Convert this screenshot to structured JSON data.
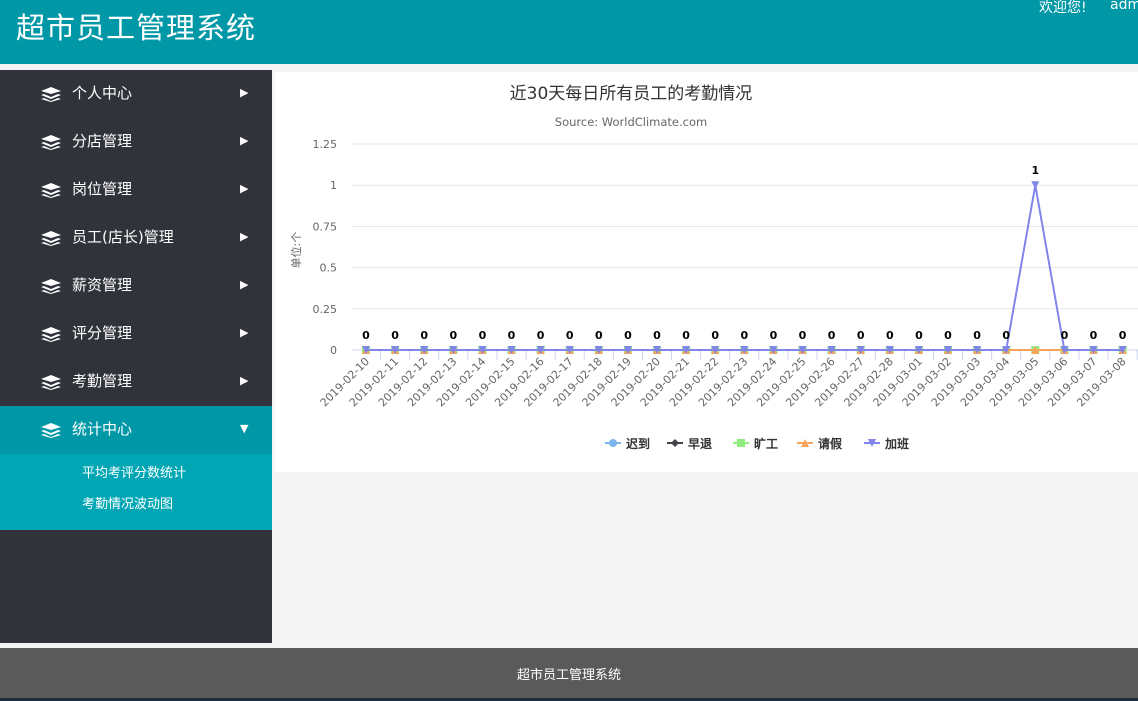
{
  "header": {
    "title": "超市员工管理系统",
    "welcome": "欢迎您!",
    "user": "adm"
  },
  "sidebar": {
    "items": [
      {
        "label": "个人中心",
        "name": "personal-center"
      },
      {
        "label": "分店管理",
        "name": "branch-management"
      },
      {
        "label": "岗位管理",
        "name": "position-management"
      },
      {
        "label": "员工(店长)管理",
        "name": "employee-management"
      },
      {
        "label": "薪资管理",
        "name": "salary-management"
      },
      {
        "label": "评分管理",
        "name": "rating-management"
      },
      {
        "label": "考勤管理",
        "name": "attendance-management"
      },
      {
        "label": "统计中心",
        "name": "statistics-center",
        "active": true
      }
    ],
    "submenu": [
      {
        "label": "平均考评分数统计"
      },
      {
        "label": "考勤情况波动图"
      }
    ]
  },
  "footer": {
    "text": "超市员工管理系统"
  },
  "chart_data": {
    "type": "line",
    "title": "近30天每日所有员工的考勤情况",
    "subtitle": "Source: WorldClimate.com",
    "ylabel": "单位:个",
    "xlabel": "",
    "ylim": [
      0,
      1.25
    ],
    "yticks": [
      0,
      0.25,
      0.5,
      0.75,
      1,
      1.25
    ],
    "grid": true,
    "legend_position": "bottom",
    "categories": [
      "2019-02-10",
      "2019-02-11",
      "2019-02-12",
      "2019-02-13",
      "2019-02-14",
      "2019-02-15",
      "2019-02-16",
      "2019-02-17",
      "2019-02-18",
      "2019-02-19",
      "2019-02-20",
      "2019-02-21",
      "2019-02-22",
      "2019-02-23",
      "2019-02-24",
      "2019-02-25",
      "2019-02-26",
      "2019-02-27",
      "2019-02-28",
      "2019-03-01",
      "2019-03-02",
      "2019-03-03",
      "2019-03-04",
      "2019-03-05",
      "2019-03-06",
      "2019-03-07",
      "2019-03-08"
    ],
    "series": [
      {
        "name": "迟到",
        "color": "#7cb5ec",
        "marker": "circle",
        "values": [
          0,
          0,
          0,
          0,
          0,
          0,
          0,
          0,
          0,
          0,
          0,
          0,
          0,
          0,
          0,
          0,
          0,
          0,
          0,
          0,
          0,
          0,
          0,
          0,
          0,
          0,
          0
        ]
      },
      {
        "name": "早退",
        "color": "#434348",
        "marker": "diamond",
        "values": [
          0,
          0,
          0,
          0,
          0,
          0,
          0,
          0,
          0,
          0,
          0,
          0,
          0,
          0,
          0,
          0,
          0,
          0,
          0,
          0,
          0,
          0,
          0,
          0,
          0,
          0,
          0
        ]
      },
      {
        "name": "旷工",
        "color": "#90ed7d",
        "marker": "square",
        "values": [
          0,
          0,
          0,
          0,
          0,
          0,
          0,
          0,
          0,
          0,
          0,
          0,
          0,
          0,
          0,
          0,
          0,
          0,
          0,
          0,
          0,
          0,
          0,
          0,
          0,
          0,
          0
        ]
      },
      {
        "name": "请假",
        "color": "#f7a35c",
        "marker": "triangle",
        "values": [
          0,
          0,
          0,
          0,
          0,
          0,
          0,
          0,
          0,
          0,
          0,
          0,
          0,
          0,
          0,
          0,
          0,
          0,
          0,
          0,
          0,
          0,
          0,
          0,
          0,
          0,
          0
        ]
      },
      {
        "name": "加班",
        "color": "#8085e9",
        "marker": "triangle-down",
        "values": [
          0,
          0,
          0,
          0,
          0,
          0,
          0,
          0,
          0,
          0,
          0,
          0,
          0,
          0,
          0,
          0,
          0,
          0,
          0,
          0,
          0,
          0,
          0,
          1,
          0,
          0,
          0
        ]
      }
    ],
    "data_labels": [
      0,
      0,
      0,
      0,
      0,
      0,
      0,
      0,
      0,
      0,
      0,
      0,
      0,
      0,
      0,
      0,
      0,
      0,
      0,
      0,
      0,
      0,
      0,
      1,
      0,
      0,
      0
    ]
  }
}
